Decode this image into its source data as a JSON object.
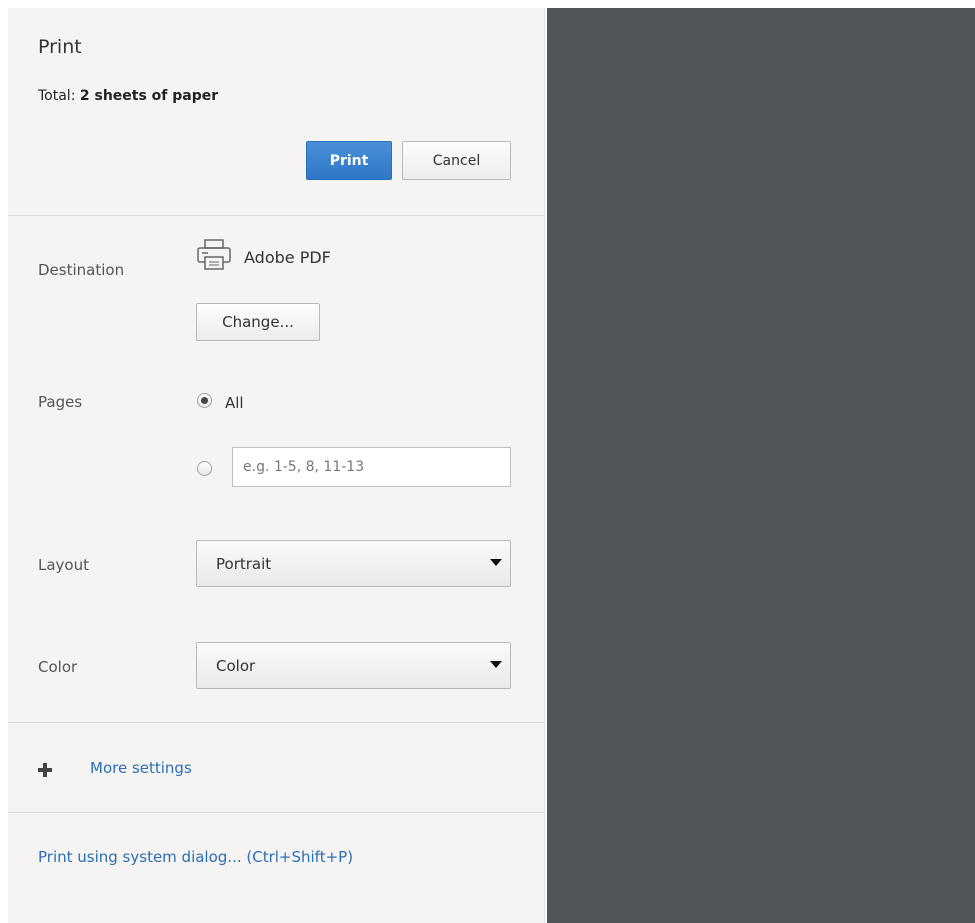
{
  "header": {
    "title": "Print",
    "total_label": "Total: ",
    "total_value": "2 sheets of paper"
  },
  "actions": {
    "print_label": "Print",
    "cancel_label": "Cancel"
  },
  "destination": {
    "label": "Destination",
    "name": "Adobe PDF",
    "change_label": "Change..."
  },
  "pages": {
    "label": "Pages",
    "all_label": "All",
    "selected": "all",
    "range_placeholder": "e.g. 1-5, 8, 11-13",
    "range_value": ""
  },
  "layout": {
    "label": "Layout",
    "value": "Portrait"
  },
  "color": {
    "label": "Color",
    "value": "Color"
  },
  "more_settings": {
    "label": "More settings"
  },
  "system_dialog": {
    "label": "Print using system dialog... (Ctrl+Shift+P)"
  },
  "colors": {
    "sidebar_bg": "#f5f4f2",
    "preview_bg": "#525659",
    "accent": "#2f78c8",
    "link": "#2a6eb5"
  }
}
